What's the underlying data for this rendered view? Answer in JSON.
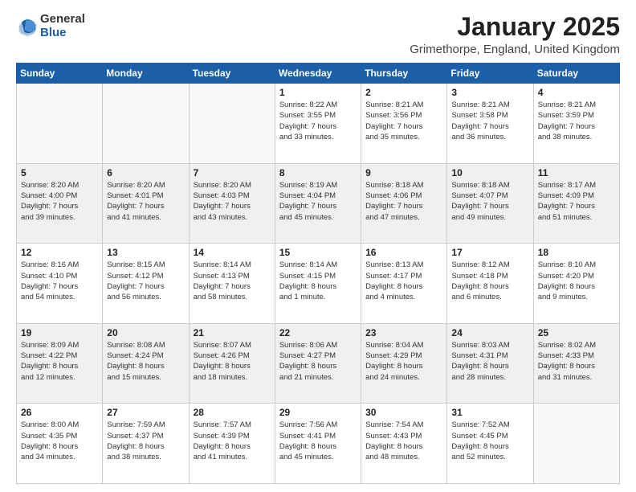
{
  "logo": {
    "general": "General",
    "blue": "Blue"
  },
  "title": "January 2025",
  "location": "Grimethorpe, England, United Kingdom",
  "weekdays": [
    "Sunday",
    "Monday",
    "Tuesday",
    "Wednesday",
    "Thursday",
    "Friday",
    "Saturday"
  ],
  "weeks": [
    [
      {
        "day": "",
        "info": ""
      },
      {
        "day": "",
        "info": ""
      },
      {
        "day": "",
        "info": ""
      },
      {
        "day": "1",
        "info": "Sunrise: 8:22 AM\nSunset: 3:55 PM\nDaylight: 7 hours\nand 33 minutes."
      },
      {
        "day": "2",
        "info": "Sunrise: 8:21 AM\nSunset: 3:56 PM\nDaylight: 7 hours\nand 35 minutes."
      },
      {
        "day": "3",
        "info": "Sunrise: 8:21 AM\nSunset: 3:58 PM\nDaylight: 7 hours\nand 36 minutes."
      },
      {
        "day": "4",
        "info": "Sunrise: 8:21 AM\nSunset: 3:59 PM\nDaylight: 7 hours\nand 38 minutes."
      }
    ],
    [
      {
        "day": "5",
        "info": "Sunrise: 8:20 AM\nSunset: 4:00 PM\nDaylight: 7 hours\nand 39 minutes."
      },
      {
        "day": "6",
        "info": "Sunrise: 8:20 AM\nSunset: 4:01 PM\nDaylight: 7 hours\nand 41 minutes."
      },
      {
        "day": "7",
        "info": "Sunrise: 8:20 AM\nSunset: 4:03 PM\nDaylight: 7 hours\nand 43 minutes."
      },
      {
        "day": "8",
        "info": "Sunrise: 8:19 AM\nSunset: 4:04 PM\nDaylight: 7 hours\nand 45 minutes."
      },
      {
        "day": "9",
        "info": "Sunrise: 8:18 AM\nSunset: 4:06 PM\nDaylight: 7 hours\nand 47 minutes."
      },
      {
        "day": "10",
        "info": "Sunrise: 8:18 AM\nSunset: 4:07 PM\nDaylight: 7 hours\nand 49 minutes."
      },
      {
        "day": "11",
        "info": "Sunrise: 8:17 AM\nSunset: 4:09 PM\nDaylight: 7 hours\nand 51 minutes."
      }
    ],
    [
      {
        "day": "12",
        "info": "Sunrise: 8:16 AM\nSunset: 4:10 PM\nDaylight: 7 hours\nand 54 minutes."
      },
      {
        "day": "13",
        "info": "Sunrise: 8:15 AM\nSunset: 4:12 PM\nDaylight: 7 hours\nand 56 minutes."
      },
      {
        "day": "14",
        "info": "Sunrise: 8:14 AM\nSunset: 4:13 PM\nDaylight: 7 hours\nand 58 minutes."
      },
      {
        "day": "15",
        "info": "Sunrise: 8:14 AM\nSunset: 4:15 PM\nDaylight: 8 hours\nand 1 minute."
      },
      {
        "day": "16",
        "info": "Sunrise: 8:13 AM\nSunset: 4:17 PM\nDaylight: 8 hours\nand 4 minutes."
      },
      {
        "day": "17",
        "info": "Sunrise: 8:12 AM\nSunset: 4:18 PM\nDaylight: 8 hours\nand 6 minutes."
      },
      {
        "day": "18",
        "info": "Sunrise: 8:10 AM\nSunset: 4:20 PM\nDaylight: 8 hours\nand 9 minutes."
      }
    ],
    [
      {
        "day": "19",
        "info": "Sunrise: 8:09 AM\nSunset: 4:22 PM\nDaylight: 8 hours\nand 12 minutes."
      },
      {
        "day": "20",
        "info": "Sunrise: 8:08 AM\nSunset: 4:24 PM\nDaylight: 8 hours\nand 15 minutes."
      },
      {
        "day": "21",
        "info": "Sunrise: 8:07 AM\nSunset: 4:26 PM\nDaylight: 8 hours\nand 18 minutes."
      },
      {
        "day": "22",
        "info": "Sunrise: 8:06 AM\nSunset: 4:27 PM\nDaylight: 8 hours\nand 21 minutes."
      },
      {
        "day": "23",
        "info": "Sunrise: 8:04 AM\nSunset: 4:29 PM\nDaylight: 8 hours\nand 24 minutes."
      },
      {
        "day": "24",
        "info": "Sunrise: 8:03 AM\nSunset: 4:31 PM\nDaylight: 8 hours\nand 28 minutes."
      },
      {
        "day": "25",
        "info": "Sunrise: 8:02 AM\nSunset: 4:33 PM\nDaylight: 8 hours\nand 31 minutes."
      }
    ],
    [
      {
        "day": "26",
        "info": "Sunrise: 8:00 AM\nSunset: 4:35 PM\nDaylight: 8 hours\nand 34 minutes."
      },
      {
        "day": "27",
        "info": "Sunrise: 7:59 AM\nSunset: 4:37 PM\nDaylight: 8 hours\nand 38 minutes."
      },
      {
        "day": "28",
        "info": "Sunrise: 7:57 AM\nSunset: 4:39 PM\nDaylight: 8 hours\nand 41 minutes."
      },
      {
        "day": "29",
        "info": "Sunrise: 7:56 AM\nSunset: 4:41 PM\nDaylight: 8 hours\nand 45 minutes."
      },
      {
        "day": "30",
        "info": "Sunrise: 7:54 AM\nSunset: 4:43 PM\nDaylight: 8 hours\nand 48 minutes."
      },
      {
        "day": "31",
        "info": "Sunrise: 7:52 AM\nSunset: 4:45 PM\nDaylight: 8 hours\nand 52 minutes."
      },
      {
        "day": "",
        "info": ""
      }
    ]
  ]
}
